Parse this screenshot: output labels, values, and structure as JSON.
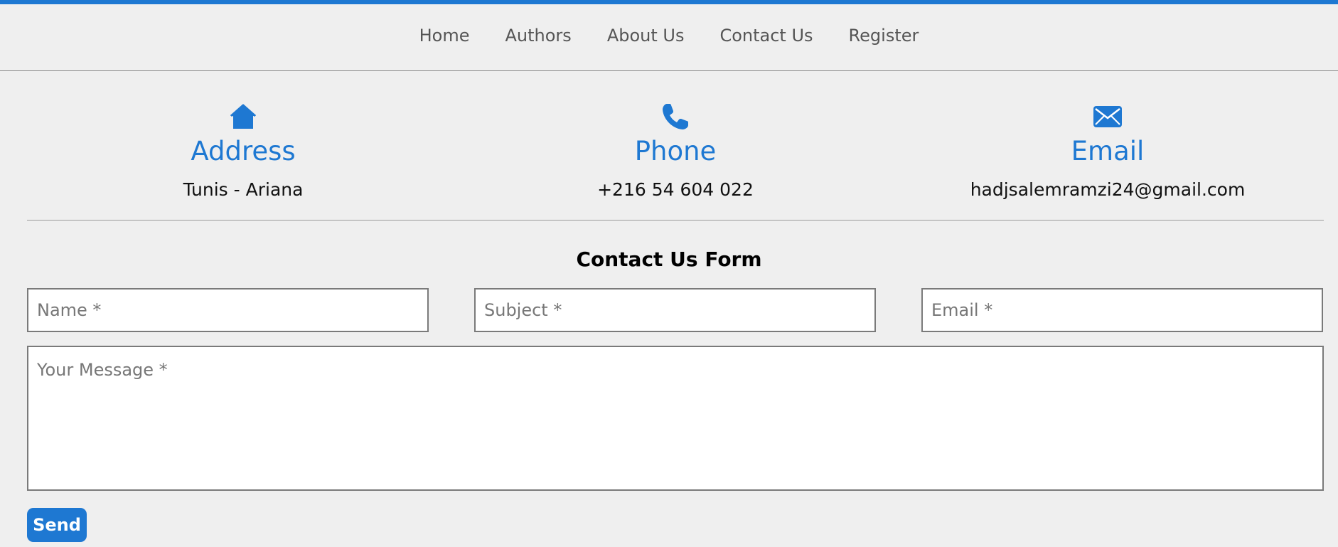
{
  "nav": {
    "items": [
      {
        "label": "Home"
      },
      {
        "label": "Authors"
      },
      {
        "label": "About Us"
      },
      {
        "label": "Contact Us"
      },
      {
        "label": "Register"
      }
    ]
  },
  "contact_info": {
    "address": {
      "icon": "home-icon",
      "title": "Address",
      "value": "Tunis - Ariana"
    },
    "phone": {
      "icon": "phone-icon",
      "title": "Phone",
      "value": "+216 54 604 022"
    },
    "email": {
      "icon": "envelope-icon",
      "title": "Email",
      "value": "hadjsalemramzi24@gmail.com"
    }
  },
  "form": {
    "title": "Contact Us Form",
    "name_placeholder": "Name *",
    "subject_placeholder": "Subject *",
    "email_placeholder": "Email *",
    "message_placeholder": "Your Message *",
    "send_label": "Send"
  },
  "colors": {
    "accent": "#1e78d2",
    "background": "#efefef",
    "nav_text": "#555555"
  }
}
